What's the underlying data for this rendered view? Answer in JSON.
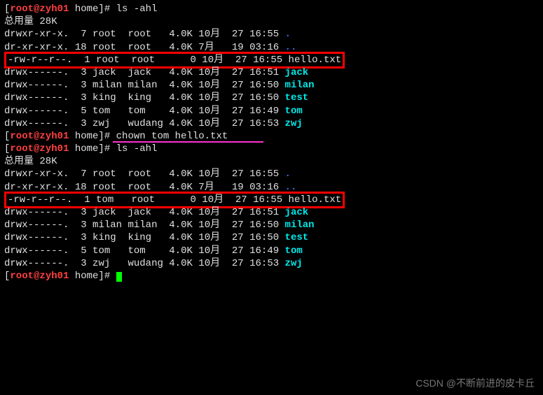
{
  "prompt": {
    "user": "root",
    "host": "zyh01",
    "path": "home",
    "symbol": "#"
  },
  "commands": {
    "ls1": "ls -ahl",
    "chown": "chown tom hello.txt",
    "ls2": "ls -ahl"
  },
  "summary": {
    "label": "总用量",
    "size": "28K"
  },
  "listing1": [
    {
      "perm": "drwxr-xr-x.",
      "links": "7",
      "owner": "root",
      "group": "root",
      "size": "4.0K",
      "mon": "10月",
      "day": "27",
      "time": "16:55",
      "name": ".",
      "color": "blue-bold",
      "hl": false
    },
    {
      "perm": "dr-xr-xr-x.",
      "links": "18",
      "owner": "root",
      "group": "root",
      "size": "4.0K",
      "mon": "7月",
      "day": "19",
      "time": "03:16",
      "name": "..",
      "color": "blue-bold",
      "hl": false
    },
    {
      "perm": "-rw-r--r--.",
      "links": "1",
      "owner": "root",
      "group": "root",
      "size": "0",
      "mon": "10月",
      "day": "27",
      "time": "16:55",
      "name": "hello.txt",
      "color": "white",
      "hl": true
    },
    {
      "perm": "drwx------.",
      "links": "3",
      "owner": "jack",
      "group": "jack",
      "size": "4.0K",
      "mon": "10月",
      "day": "27",
      "time": "16:51",
      "name": "jack",
      "color": "cyan-bold",
      "hl": false
    },
    {
      "perm": "drwx------.",
      "links": "3",
      "owner": "milan",
      "group": "milan",
      "size": "4.0K",
      "mon": "10月",
      "day": "27",
      "time": "16:50",
      "name": "milan",
      "color": "cyan-bold",
      "hl": false
    },
    {
      "perm": "drwx------.",
      "links": "3",
      "owner": "king",
      "group": "king",
      "size": "4.0K",
      "mon": "10月",
      "day": "27",
      "time": "16:50",
      "name": "test",
      "color": "cyan-bold",
      "hl": false
    },
    {
      "perm": "drwx------.",
      "links": "5",
      "owner": "tom",
      "group": "tom",
      "size": "4.0K",
      "mon": "10月",
      "day": "27",
      "time": "16:49",
      "name": "tom",
      "color": "cyan-bold",
      "hl": false
    },
    {
      "perm": "drwx------.",
      "links": "3",
      "owner": "zwj",
      "group": "wudang",
      "size": "4.0K",
      "mon": "10月",
      "day": "27",
      "time": "16:53",
      "name": "zwj",
      "color": "cyan-bold",
      "hl": false
    }
  ],
  "listing2": [
    {
      "perm": "drwxr-xr-x.",
      "links": "7",
      "owner": "root",
      "group": "root",
      "size": "4.0K",
      "mon": "10月",
      "day": "27",
      "time": "16:55",
      "name": ".",
      "color": "blue-bold",
      "hl": false
    },
    {
      "perm": "dr-xr-xr-x.",
      "links": "18",
      "owner": "root",
      "group": "root",
      "size": "4.0K",
      "mon": "7月",
      "day": "19",
      "time": "03:16",
      "name": "..",
      "color": "blue-bold",
      "hl": false
    },
    {
      "perm": "-rw-r--r--.",
      "links": "1",
      "owner": "tom",
      "group": "root",
      "size": "0",
      "mon": "10月",
      "day": "27",
      "time": "16:55",
      "name": "hello.txt",
      "color": "white",
      "hl": true
    },
    {
      "perm": "drwx------.",
      "links": "3",
      "owner": "jack",
      "group": "jack",
      "size": "4.0K",
      "mon": "10月",
      "day": "27",
      "time": "16:51",
      "name": "jack",
      "color": "cyan-bold",
      "hl": false
    },
    {
      "perm": "drwx------.",
      "links": "3",
      "owner": "milan",
      "group": "milan",
      "size": "4.0K",
      "mon": "10月",
      "day": "27",
      "time": "16:50",
      "name": "milan",
      "color": "cyan-bold",
      "hl": false
    },
    {
      "perm": "drwx------.",
      "links": "3",
      "owner": "king",
      "group": "king",
      "size": "4.0K",
      "mon": "10月",
      "day": "27",
      "time": "16:50",
      "name": "test",
      "color": "cyan-bold",
      "hl": false
    },
    {
      "perm": "drwx------.",
      "links": "5",
      "owner": "tom",
      "group": "tom",
      "size": "4.0K",
      "mon": "10月",
      "day": "27",
      "time": "16:49",
      "name": "tom",
      "color": "cyan-bold",
      "hl": false
    },
    {
      "perm": "drwx------.",
      "links": "3",
      "owner": "zwj",
      "group": "wudang",
      "size": "4.0K",
      "mon": "10月",
      "day": "27",
      "time": "16:53",
      "name": "zwj",
      "color": "cyan-bold",
      "hl": false
    }
  ],
  "watermark": "CSDN @不断前进的皮卡丘"
}
